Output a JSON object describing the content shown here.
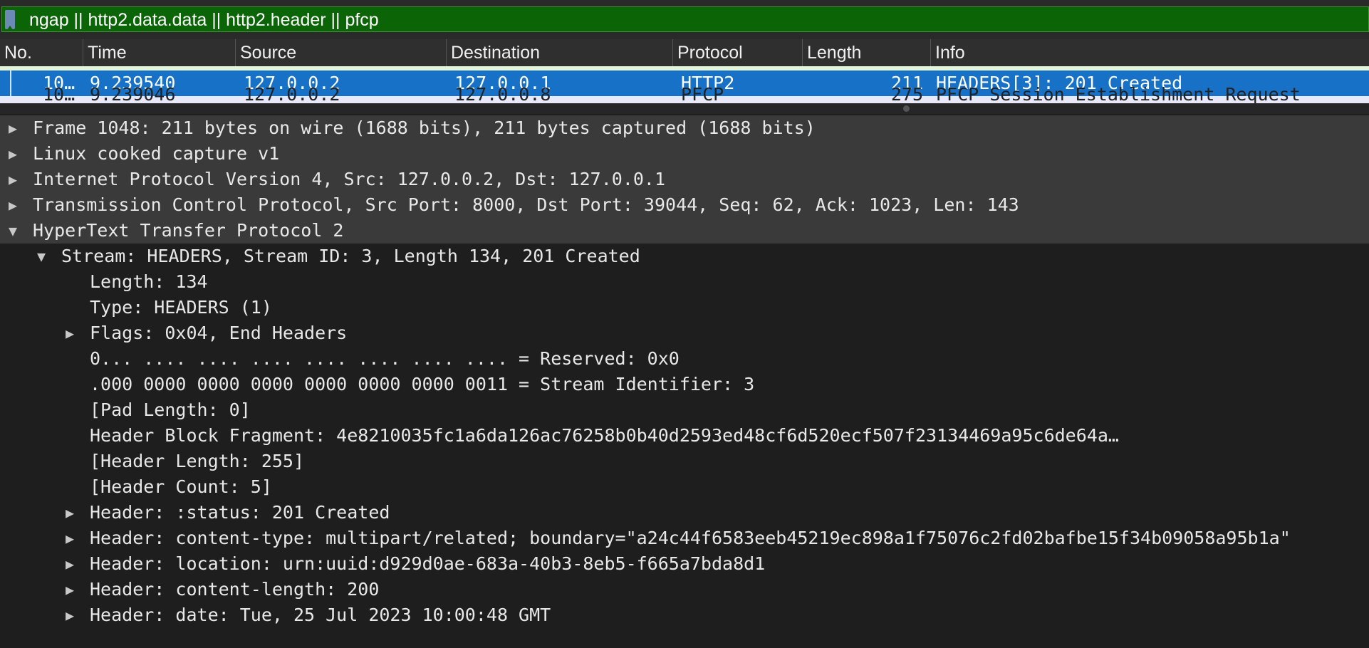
{
  "filter": {
    "text": "ngap || http2.data.data || http2.header || pfcp",
    "color": "#0b6406"
  },
  "columns": [
    "No.",
    "Time",
    "Source",
    "Destination",
    "Protocol",
    "Length",
    "Info"
  ],
  "selected_packet": {
    "no": "10…",
    "time": "9.239540",
    "source": "127.0.0.2",
    "destination": "127.0.0.1",
    "protocol": "HTTP2",
    "length": "211",
    "info": "HEADERS[3]: 201 Created"
  },
  "next_packet": {
    "no": "10…",
    "time": "9.239046",
    "source": "127.0.0.2",
    "destination": "127.0.0.8",
    "protocol": "PFCP",
    "length": "275",
    "info": "PFCP Session Establishment Request"
  },
  "tree": [
    {
      "text": "Frame 1048: 211 bytes on wire (1688 bits), 211 bytes captured (1688 bits)",
      "arrow": "▶"
    },
    {
      "text": "Linux cooked capture v1",
      "arrow": "▶"
    },
    {
      "text": "Internet Protocol Version 4, Src: 127.0.0.2, Dst: 127.0.0.1",
      "arrow": "▶"
    },
    {
      "text": "Transmission Control Protocol, Src Port: 8000, Dst Port: 39044, Seq: 62, Ack: 1023, Len: 143",
      "arrow": "▶"
    },
    {
      "text": "HyperText Transfer Protocol 2",
      "arrow": "▼"
    },
    {
      "text": "Stream: HEADERS, Stream ID: 3, Length 134, 201 Created",
      "arrow": "▼"
    },
    {
      "text": "Length: 134",
      "arrow": ""
    },
    {
      "text": "Type: HEADERS (1)",
      "arrow": ""
    },
    {
      "text": "Flags: 0x04, End Headers",
      "arrow": "▶"
    },
    {
      "text": "0... .... .... .... .... .... .... .... = Reserved: 0x0",
      "arrow": ""
    },
    {
      "text": ".000 0000 0000 0000 0000 0000 0000 0011 = Stream Identifier: 3",
      "arrow": ""
    },
    {
      "text": "[Pad Length: 0]",
      "arrow": ""
    },
    {
      "text": "Header Block Fragment: 4e8210035fc1a6da126ac76258b0b40d2593ed48cf6d520ecf507f23134469a95c6de64a…",
      "arrow": ""
    },
    {
      "text": "[Header Length: 255]",
      "arrow": ""
    },
    {
      "text": "[Header Count: 5]",
      "arrow": ""
    },
    {
      "text": "Header: :status: 201 Created",
      "arrow": "▶"
    },
    {
      "text": "Header: content-type: multipart/related; boundary=\"a24c44f6583eeb45219ec898a1f75076c2fd02bafbe15f34b09058a95b1a\"",
      "arrow": "▶"
    },
    {
      "text": "Header: location: urn:uuid:d929d0ae-683a-40b3-8eb5-f665a7bda8d1",
      "arrow": "▶"
    },
    {
      "text": "Header: content-length: 200",
      "arrow": "▶"
    },
    {
      "text": "Header: date: Tue, 25 Jul 2023 10:00:48 GMT",
      "arrow": "▶"
    }
  ]
}
